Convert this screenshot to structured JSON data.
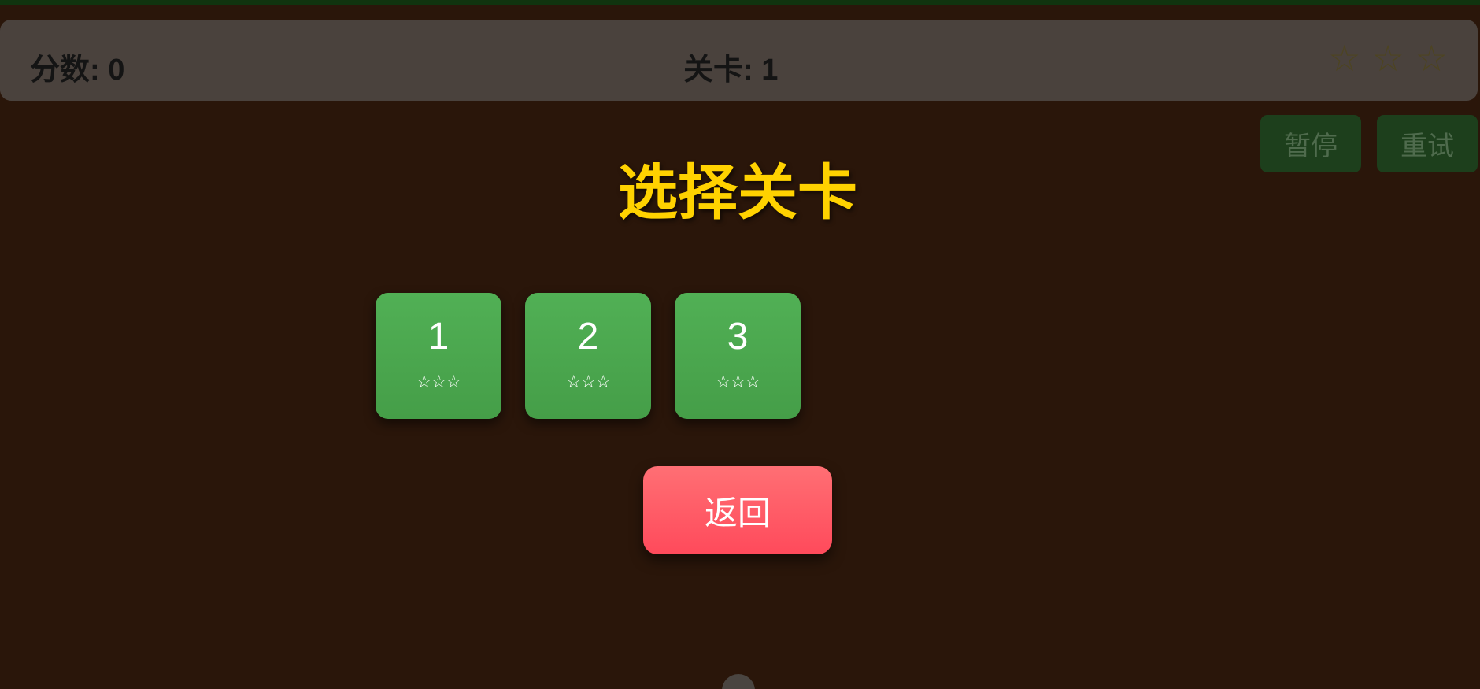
{
  "hud": {
    "score_text": "分数: 0",
    "level_text": "关卡: 1",
    "stars": [
      "☆",
      "☆",
      "☆"
    ]
  },
  "controls": {
    "pause_label": "暂停",
    "retry_label": "重试"
  },
  "menu": {
    "title": "选择关卡",
    "levels": [
      {
        "number": "1",
        "stars": "☆☆☆"
      },
      {
        "number": "2",
        "stars": "☆☆☆"
      },
      {
        "number": "3",
        "stars": "☆☆☆"
      }
    ],
    "back_label": "返回"
  },
  "colors": {
    "background": "#2a160a",
    "title": "#ffd200",
    "level_card": "#4caf50",
    "back_button": "#ff5a66"
  }
}
